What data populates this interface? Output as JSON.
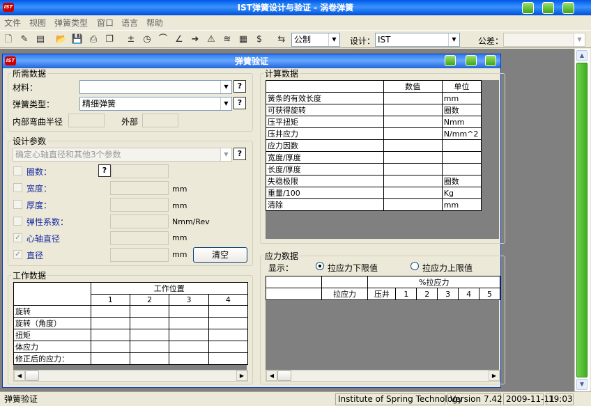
{
  "window": {
    "title": "IST弹簧设计与验证 - 涡卷弹簧",
    "icon": "IST"
  },
  "menu": [
    "文件",
    "视图",
    "弹簧类型",
    "窗口",
    "语言",
    "帮助"
  ],
  "toolbar": {
    "units_value": "公制",
    "design_label": "设计：",
    "design_value": "IST",
    "tolerance_label": "公差：",
    "tolerance_value": ""
  },
  "child": {
    "title": "弹簧验证"
  },
  "required": {
    "legend": "所需数据",
    "material_label": "材料：",
    "material_value": "",
    "type_label": "弹簧类型：",
    "type_value": "精细弹簧",
    "bend_label": "内部弯曲半径",
    "outer_label": "外部"
  },
  "design": {
    "legend": "设计参数",
    "mode_value": "确定心轴直径和其他3个参数",
    "params": [
      {
        "label": "圈数：",
        "unit": "",
        "checked": false
      },
      {
        "label": "宽度：",
        "unit": "mm",
        "checked": false
      },
      {
        "label": "厚度：",
        "unit": "mm",
        "checked": false
      },
      {
        "label": "弹性系数：",
        "unit": "Nmm/Rev",
        "checked": false
      },
      {
        "label": "心轴直径",
        "unit": "mm",
        "checked": true
      },
      {
        "label": "直径",
        "unit": "mm",
        "checked": true
      }
    ],
    "clear_button": "清空"
  },
  "work": {
    "legend": "工作数据",
    "header": "工作位置",
    "cols": [
      "1",
      "2",
      "3",
      "4"
    ],
    "rows": [
      "旋转",
      "旋转（角度）",
      "扭矩",
      "体应力",
      "修正后的应力："
    ]
  },
  "calc": {
    "legend": "计算数据",
    "col_value": "数值",
    "col_unit": "单位",
    "rows": [
      {
        "name": "簧条的有效长度",
        "unit": "mm"
      },
      {
        "name": "可获得旋转",
        "unit": "圈数"
      },
      {
        "name": "压平扭矩",
        "unit": "Nmm"
      },
      {
        "name": "压井应力",
        "unit": "N/mm^2"
      },
      {
        "name": "应力因数",
        "unit": ""
      },
      {
        "name": "宽度/厚度",
        "unit": ""
      },
      {
        "name": "长度/厚度",
        "unit": ""
      },
      {
        "name": "失稳极限",
        "unit": "圈数"
      },
      {
        "name": "重量/100",
        "unit": "Kg"
      },
      {
        "name": "清除",
        "unit": "mm"
      }
    ]
  },
  "stress": {
    "legend": "应力数据",
    "display_label": "显示：",
    "opt_lower": "拉应力下限值",
    "opt_upper": "拉应力上限值",
    "header_pct": "%拉应力",
    "col_tensile": "拉应力",
    "col_press": "压井",
    "cols": [
      "1",
      "2",
      "3",
      "4",
      "5"
    ]
  },
  "status": {
    "left": "弹簧验证",
    "org": "Institute of Spring Technology",
    "version": "Version 7.42",
    "date": "2009-11-11",
    "time": "19:03"
  }
}
